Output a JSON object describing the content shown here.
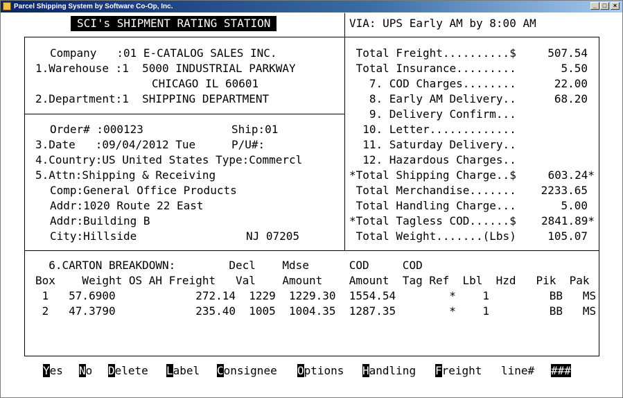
{
  "window": {
    "title": "Parcel Shipping System by Software Co-Op, Inc.",
    "controls": {
      "minimize": "_",
      "maximize": "□",
      "close": "×"
    }
  },
  "header": {
    "title": "SCI's SHIPMENT RATING STATION",
    "via": "VIA: UPS Early AM by 8:00 AM"
  },
  "company": {
    "company_line": "Company   :01 E-CATALOG SALES INC.",
    "warehouse_line": "1.Warehouse :1  5000 INDUSTRIAL PARKWAY",
    "city_line": "CHICAGO IL 60601",
    "department_line": "2.Department:1  SHIPPING DEPARTMENT"
  },
  "order": {
    "order_line": "Order# :000123",
    "ship_line": "Ship:01",
    "date_line": "3.Date   :09/04/2012 Tue",
    "pu_line": "P/U#:",
    "country_line": "4.Country:US United States Type:Commercl",
    "attn_line": "5.Attn:Shipping & Receiving",
    "comp_line": "Comp:General Office Products",
    "addr1_line": "Addr:1020 Route 22 East",
    "addr2_line": "Addr:Building B",
    "city_line": "City:Hillside",
    "state_zip": "NJ 07205"
  },
  "charges": [
    {
      "label": " Total Freight..........$",
      "value": "507.54"
    },
    {
      "label": " Total Insurance.........",
      "value": "5.50"
    },
    {
      "label": "   7. COD Charges........",
      "value": "22.00"
    },
    {
      "label": "   8. Early AM Delivery..",
      "value": "68.20"
    },
    {
      "label": "   9. Delivery Confirm...",
      "value": ""
    },
    {
      "label": "  10. Letter.............",
      "value": ""
    },
    {
      "label": "  11. Saturday Delivery..",
      "value": ""
    },
    {
      "label": "  12. Hazardous Charges..",
      "value": ""
    },
    {
      "label": "*Total Shipping Charge..$",
      "value": "603.24*"
    },
    {
      "label": " Total Merchandise.......",
      "value": "2233.65"
    },
    {
      "label": " Total Handling Charge...",
      "value": "5.00"
    },
    {
      "label": "*Total Tagless COD......$",
      "value": "2841.89*"
    },
    {
      "label": " Total Weight.......(Lbs)",
      "value": "105.07"
    }
  ],
  "carton": {
    "header1": "  6.CARTON BREAKDOWN:        Decl    Mdse      COD     COD",
    "header2": "Box    Weight OS AH Freight   Val    Amount    Amount  Tag Ref  Lbl  Hzd   Pik  Pak",
    "rows": [
      " 1   57.6900            272.14  1229  1229.30  1554.54        *    1         BB   MS",
      " 2   47.3790            235.40  1005  1004.35  1287.35        *    1         BB   MS"
    ]
  },
  "function_keys": [
    {
      "hot": "Y",
      "rest": "es"
    },
    {
      "hot": "N",
      "rest": "o"
    },
    {
      "hot": "D",
      "rest": "elete"
    },
    {
      "hot": "L",
      "rest": "abel"
    },
    {
      "hot": "C",
      "rest": "onsignee"
    },
    {
      "hot": "O",
      "rest": "ptions"
    },
    {
      "hot": "H",
      "rest": "andling"
    },
    {
      "hot": "F",
      "rest": "reight"
    },
    {
      "hot": "",
      "rest": "line#"
    },
    {
      "hot": "###",
      "rest": ""
    }
  ]
}
